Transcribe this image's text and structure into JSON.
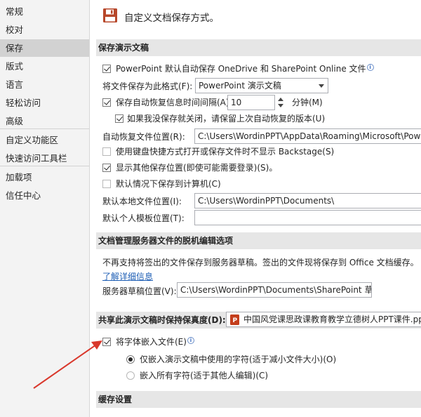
{
  "sidebar": {
    "items": [
      {
        "label": "常规"
      },
      {
        "label": "校对"
      },
      {
        "label": "保存"
      },
      {
        "label": "版式"
      },
      {
        "label": "语言"
      },
      {
        "label": "轻松访问"
      },
      {
        "label": "高级"
      },
      {
        "label": "自定义功能区"
      },
      {
        "label": "快速访问工具栏"
      },
      {
        "label": "加载项"
      },
      {
        "label": "信任中心"
      }
    ],
    "selected": "保存"
  },
  "header": {
    "icon": "save-floppy-icon",
    "title": "自定义文档保存方式。"
  },
  "save_section": {
    "title": "保存演示文稿",
    "autosave_label": "PowerPoint 默认自动保存 OneDrive 和 SharePoint Online 文件",
    "autosave_checked": true,
    "format_label": "将文件保存为此格式(F):",
    "format_value": "PowerPoint 演示文稿",
    "autorecover_label": "保存自动恢复信息时间间隔(A)",
    "autorecover_checked": true,
    "autorecover_value": "10",
    "minutes_label": "分钟(M)",
    "keep_last_label": "如果我没保存就关闭，请保留上次自动恢复的版本(U)",
    "keep_last_checked": true,
    "autorecover_location_label": "自动恢复文件位置(R):",
    "autorecover_location_value": "C:\\Users\\WordinPPT\\AppData\\Roaming\\Microsoft\\PowerPoint\\",
    "no_backstage_label": "使用键盘快捷方式打开或保存文件时不显示 Backstage(S)",
    "no_backstage_checked": false,
    "show_additional_label": "显示其他保存位置(即使可能需要登录)(S)。",
    "show_additional_checked": true,
    "default_computer_label": "默认情况下保存到计算机(C)",
    "default_computer_checked": false,
    "local_location_label": "默认本地文件位置(I):",
    "local_location_value": "C:\\Users\\WordinPPT\\Documents\\",
    "template_location_label": "默认个人模板位置(T):",
    "template_location_value": ""
  },
  "offline_section": {
    "title": "文档管理服务器文件的脱机编辑选项",
    "description": "不再支持将签出的文件保存到服务器草稿。签出的文件现将保存到 Office 文档缓存。",
    "learn_more": "了解详细信息",
    "drafts_label": "服务器草稿位置(V):",
    "drafts_value": "C:\\Users\\WordinPPT\\Documents\\SharePoint 草稿\\"
  },
  "fidelity_section": {
    "title": "共享此演示文稿时保持保真度(D):",
    "file_value": "中国风党课思政课教育教学立德树人PPT课件.pptx",
    "embed_fonts_label": "将字体嵌入文件(E)",
    "embed_fonts_checked": true,
    "embed_used_label": "仅嵌入演示文稿中使用的字符(适于减小文件大小)(O)",
    "embed_all_label": "嵌入所有字符(适于其他人编辑)(C)",
    "embed_option_selected": "used"
  },
  "cache_section": {
    "title": "缓存设置"
  },
  "colors": {
    "annotation_arrow": "#d9382c",
    "selected_nav": "#d2d2d2",
    "section_bar": "#e6e6e6",
    "save_icon": "#b7472a"
  }
}
